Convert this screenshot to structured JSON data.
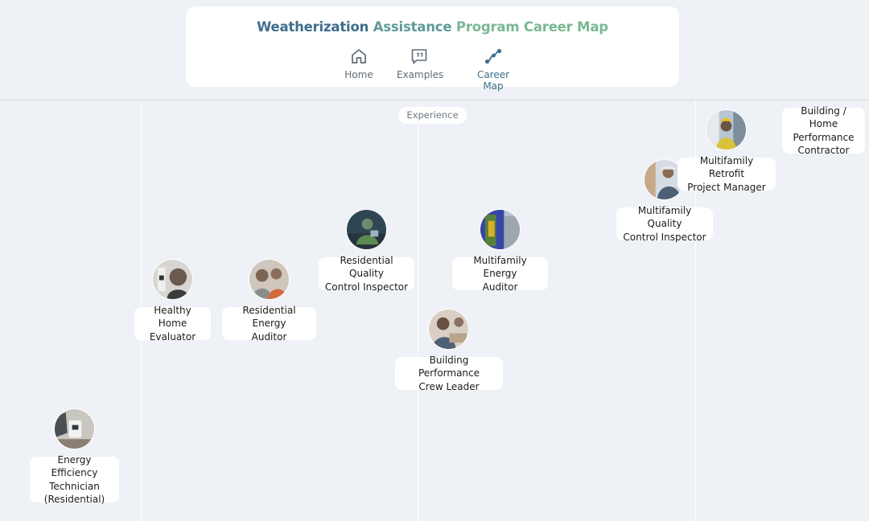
{
  "header": {
    "title_part1": "Weatherization",
    "title_part2": "Assistance",
    "title_part3": "Program Career Map",
    "nav": [
      {
        "label": "Home",
        "icon": "home-icon",
        "active": false
      },
      {
        "label": "Examples",
        "icon": "quote-bubble-icon",
        "active": false
      },
      {
        "label": "Career Map",
        "icon": "career-path-icon",
        "active": true
      }
    ]
  },
  "axis": {
    "experience_label": "Experience"
  },
  "colors": {
    "background": "#eef1f5",
    "title_blue": "#3f6e8c",
    "title_green": "#7ab892",
    "active_nav": "#3e6f8d"
  },
  "careers": [
    {
      "name": "Energy Efficiency\nTechnician\n(Residential)",
      "photo": "technician-photo"
    },
    {
      "name": "Healthy Home\nEvaluator",
      "photo": "evaluator-photo"
    },
    {
      "name": "Residential Energy\nAuditor",
      "photo": "auditor-photo"
    },
    {
      "name": "Residential Quality\nControl Inspector",
      "photo": "qc-inspector-photo"
    },
    {
      "name": "Building Performance\nCrew Leader",
      "photo": "crew-leader-photo"
    },
    {
      "name": "Multifamily Energy\nAuditor",
      "photo": "mf-auditor-photo"
    },
    {
      "name": "Multifamily Quality\nControl Inspector",
      "photo": "mf-qc-photo"
    },
    {
      "name": "Multifamily Retrofit\nProject Manager",
      "photo": "mf-pm-photo"
    },
    {
      "name": "Building / Home\nPerformance\nContractor",
      "photo": "contractor-photo"
    }
  ]
}
